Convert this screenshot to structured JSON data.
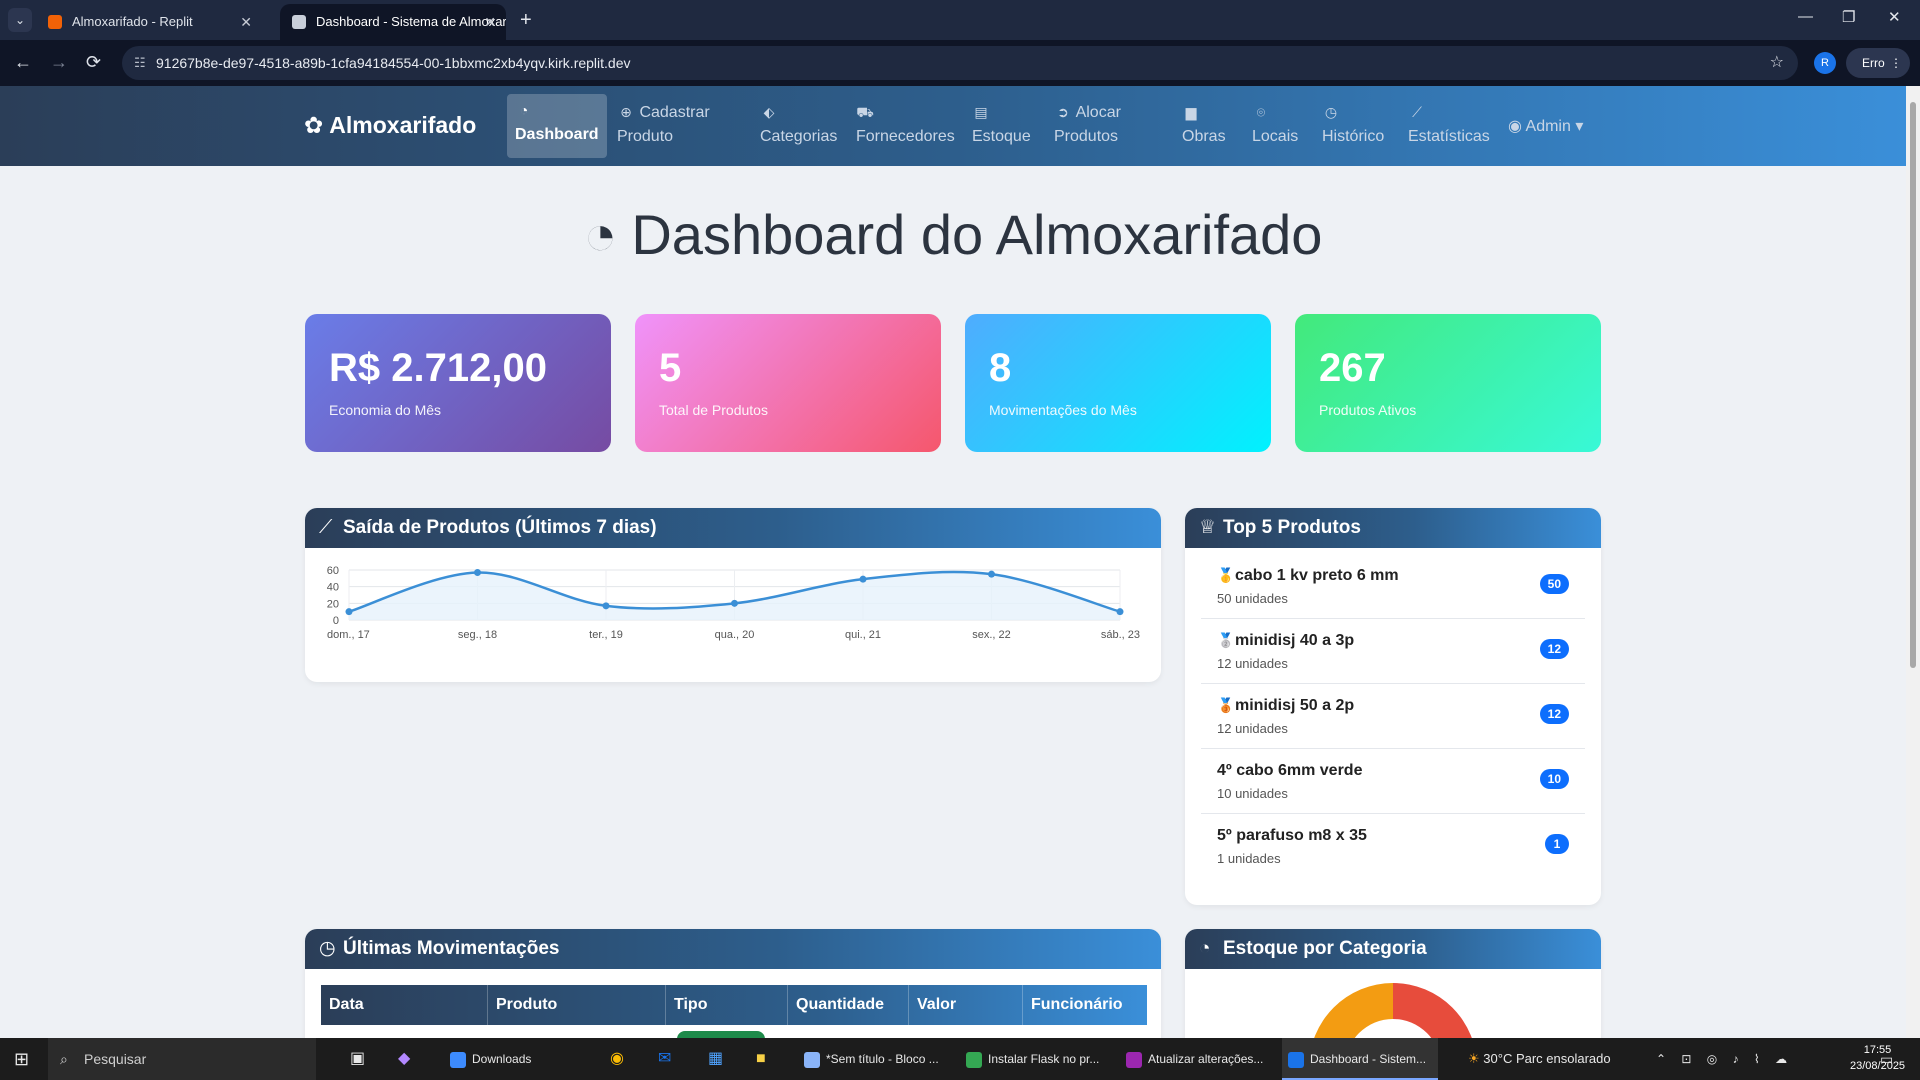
{
  "browser": {
    "tabs": [
      {
        "title": "Almoxarifado - Replit",
        "favicon_color": "#f26207"
      },
      {
        "title": "Dashboard - Sistema de Almoxarifado",
        "favicon_color": "#c9cfda"
      }
    ],
    "url": "91267b8e-de97-4518-a89b-1cfa94184554-00-1bbxmc2xb4yqv.kirk.replit.dev",
    "profile_initial": "R",
    "error_label": "Erro",
    "icons": {
      "back": "←",
      "forward": "→",
      "reload": "⟳",
      "tune": "☷",
      "star": "☆",
      "menu": "⋮",
      "minimize": "—",
      "restore": "❐",
      "close": "✕",
      "tab_close": "✕",
      "new_tab": "+",
      "tab_menu": "⌄"
    }
  },
  "navbar": {
    "brand": "Almoxarifado",
    "brand_icon": "✿",
    "items": [
      {
        "icon": "◔",
        "line1": "",
        "line2": "Dashboard"
      },
      {
        "icon": "⊕",
        "line1": "Cadastrar",
        "line2": "Produto"
      },
      {
        "icon": "⬖",
        "line1": "",
        "line2": "Categorias"
      },
      {
        "icon": "⛟",
        "line1": "",
        "line2": "Fornecedores"
      },
      {
        "icon": "▤",
        "line1": "",
        "line2": "Estoque"
      },
      {
        "icon": "➲",
        "line1": "Alocar",
        "line2": "Produtos"
      },
      {
        "icon": "▆",
        "line1": "",
        "line2": "Obras"
      },
      {
        "icon": "⌾",
        "line1": "",
        "line2": "Locais"
      },
      {
        "icon": "◷",
        "line1": "",
        "line2": "Histórico"
      },
      {
        "icon": "⟋",
        "line1": "",
        "line2": "Estatísticas"
      }
    ],
    "admin": {
      "icon": "◉",
      "label": "Admin",
      "caret": "▾"
    }
  },
  "page": {
    "title": "Dashboard do Almoxarifado",
    "title_icon": "◔"
  },
  "stats": [
    {
      "value": "R$ 2.712,00",
      "label": "Economia do Mês",
      "color_from": "#6a7de8",
      "color_to": "#764ba2"
    },
    {
      "value": "5",
      "label": "Total de Produtos",
      "color_from": "#f093fb",
      "color_to": "#f5576c"
    },
    {
      "value": "8",
      "label": "Movimentações do Mês",
      "color_from": "#4facfe",
      "color_to": "#00f2fe"
    },
    {
      "value": "267",
      "label": "Produtos Ativos",
      "color_from": "#43e97b",
      "color_to": "#38f9d7"
    }
  ],
  "saida_card": {
    "title": "Saída de Produtos (Últimos 7 dias)",
    "icon": "⟋"
  },
  "chart_data": {
    "type": "line",
    "title": "",
    "categories": [
      "dom., 17",
      "seg., 18",
      "ter., 19",
      "qua., 20",
      "qui., 21",
      "sex., 22",
      "sáb., 23"
    ],
    "values": [
      10,
      57,
      17,
      20,
      49,
      55,
      10
    ],
    "xlabel": "",
    "ylabel": "",
    "ylim": [
      0,
      60
    ],
    "yticks": [
      "0",
      "20",
      "40",
      "60"
    ],
    "grid": true,
    "line_color": "#3b8fd6",
    "fill_color": "#e6f1fb",
    "smooth": true
  },
  "top5": {
    "title": "Top 5 Produtos",
    "icon": "♕",
    "items": [
      {
        "medal": "🥇",
        "name": "cabo 1 kv preto 6 mm",
        "sub": "50 unidades",
        "badge": "50"
      },
      {
        "medal": "🥈",
        "name": "minidisj 40 a 3p",
        "sub": "12 unidades",
        "badge": "12"
      },
      {
        "medal": "🥉",
        "name": "minidisj 50 a 2p",
        "sub": "12 unidades",
        "badge": "12"
      },
      {
        "medal": "",
        "name": "4º cabo 6mm verde",
        "sub": "10 unidades",
        "badge": "10"
      },
      {
        "medal": "",
        "name": "5º parafuso m8 x 35",
        "sub": "1 unidades",
        "badge": "1"
      }
    ]
  },
  "movimentacoes": {
    "title": "Últimas Movimentações",
    "icon": "◷",
    "columns": [
      "Data",
      "Produto",
      "Tipo",
      "Quantidade",
      "Valor",
      "Funcionário"
    ]
  },
  "estoque_categoria": {
    "title": "Estoque por Categoria",
    "icon": "◔"
  },
  "taskbar": {
    "search_placeholder": "Pesquisar",
    "apps": [
      {
        "label": "Downloads",
        "color": "#3d8bfd"
      },
      {
        "label": "*Sem título - Bloco ...",
        "color": "#8ab4f8"
      },
      {
        "label": "Instalar Flask no pr...",
        "color": "#34a853"
      },
      {
        "label": "Atualizar alterações...",
        "color": "#9c27b0"
      },
      {
        "label": "Dashboard - Sistem...",
        "color": "#1a73e8"
      }
    ],
    "weather": "30°C  Parc ensolarado",
    "time": "17:55",
    "date": "23/08/2025"
  }
}
